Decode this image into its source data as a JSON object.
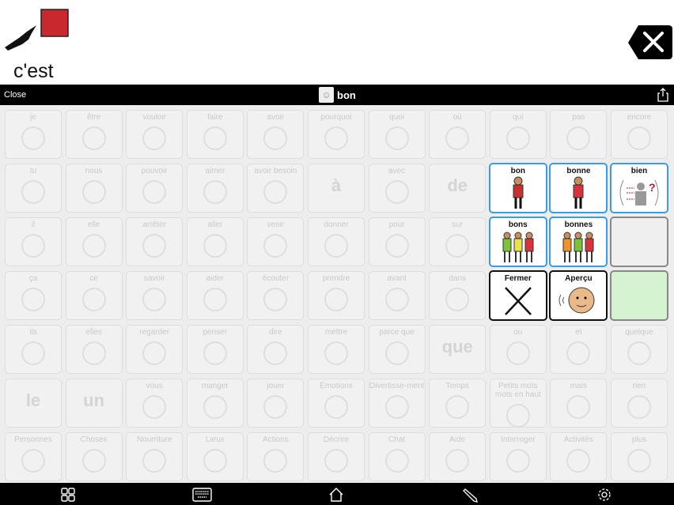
{
  "message": {
    "word": "c'est",
    "symbol": "pointing-hand-red-square-icon"
  },
  "topbar": {
    "close_label": "Close",
    "title": "bon",
    "title_icon": "man-symbol-icon",
    "share_icon": "share-icon"
  },
  "grid": {
    "rows": [
      [
        {
          "label": "je"
        },
        {
          "label": "être"
        },
        {
          "label": "vouloir"
        },
        {
          "label": "faire"
        },
        {
          "label": "avoir"
        },
        {
          "label": "pourquoi"
        },
        {
          "label": "quoi"
        },
        {
          "label": "où"
        },
        {
          "label": "qui"
        },
        {
          "label": "pas"
        },
        {
          "label": "encore"
        }
      ],
      [
        {
          "label": "tu"
        },
        {
          "label": "nous"
        },
        {
          "label": "pouvoir"
        },
        {
          "label": "aimer"
        },
        {
          "label": "avoir besoin"
        },
        {
          "big": "à"
        },
        {
          "label": "avec"
        },
        {
          "big": "de"
        },
        null,
        null,
        null
      ],
      [
        {
          "label": "il"
        },
        {
          "label": "elle"
        },
        {
          "label": "arrêter"
        },
        {
          "label": "aller"
        },
        {
          "label": "venir"
        },
        {
          "label": "donner"
        },
        {
          "label": "pour"
        },
        {
          "label": "sur"
        },
        null,
        null,
        null
      ],
      [
        {
          "label": "ça"
        },
        {
          "label": "ce"
        },
        {
          "label": "savoir"
        },
        {
          "label": "aider"
        },
        {
          "label": "écouter"
        },
        {
          "label": "prendre"
        },
        {
          "label": "avant"
        },
        {
          "label": "dans"
        },
        null,
        null,
        null
      ],
      [
        {
          "label": "ils"
        },
        {
          "label": "elles"
        },
        {
          "label": "regarder"
        },
        {
          "label": "penser"
        },
        {
          "label": "dire"
        },
        {
          "label": "mettre"
        },
        {
          "label": "parce que"
        },
        {
          "big": "que"
        },
        {
          "label": "ou"
        },
        {
          "label": "et"
        },
        {
          "label": "quelque"
        }
      ],
      [
        {
          "big": "le"
        },
        {
          "big": "un"
        },
        {
          "label": "vous"
        },
        {
          "label": "manger"
        },
        {
          "label": "jouer"
        },
        {
          "label": "Émotions"
        },
        {
          "label": "Divertisse-ment"
        },
        {
          "label": "Temps"
        },
        {
          "label": "Petits mots mots en haut"
        },
        {
          "label": "mais"
        },
        {
          "label": "rien"
        }
      ],
      [
        {
          "label": "Personnes"
        },
        {
          "label": "Choses"
        },
        {
          "label": "Nourriture"
        },
        {
          "label": "Lieux"
        },
        {
          "label": "Actions"
        },
        {
          "label": "Décrire"
        },
        {
          "label": "Chat"
        },
        {
          "label": "Aide"
        },
        {
          "label": "Interroger"
        },
        {
          "label": "Activités"
        },
        {
          "label": "plus"
        }
      ]
    ]
  },
  "popup": {
    "cells": [
      {
        "label": "bon",
        "style": "blue",
        "icon": "man-red-shirt-icon",
        "color": "#c8302f"
      },
      {
        "label": "bonne",
        "style": "blue",
        "icon": "woman-red-dress-icon",
        "color": "#d8323a"
      },
      {
        "label": "bien",
        "style": "blue",
        "icon": "person-question-icon",
        "color": "#a0202a"
      },
      {
        "label": "bons",
        "style": "blue",
        "icon": "group-people-icon",
        "color": "#7cc23a"
      },
      {
        "label": "bonnes",
        "style": "blue",
        "icon": "group-women-icon",
        "color": "#f0922a"
      },
      {
        "label": "",
        "style": "empty"
      },
      {
        "label": "Fermer",
        "style": "black",
        "icon": "close-x-icon",
        "color": "#111"
      },
      {
        "label": "Aperçu",
        "style": "black",
        "icon": "speaking-face-icon",
        "color": "#e9b98a"
      },
      {
        "label": "",
        "style": "green"
      }
    ]
  },
  "footer": {
    "icons": [
      "grid-icon",
      "keyboard-icon",
      "home-icon",
      "pencil-icon",
      "gear-icon"
    ]
  }
}
